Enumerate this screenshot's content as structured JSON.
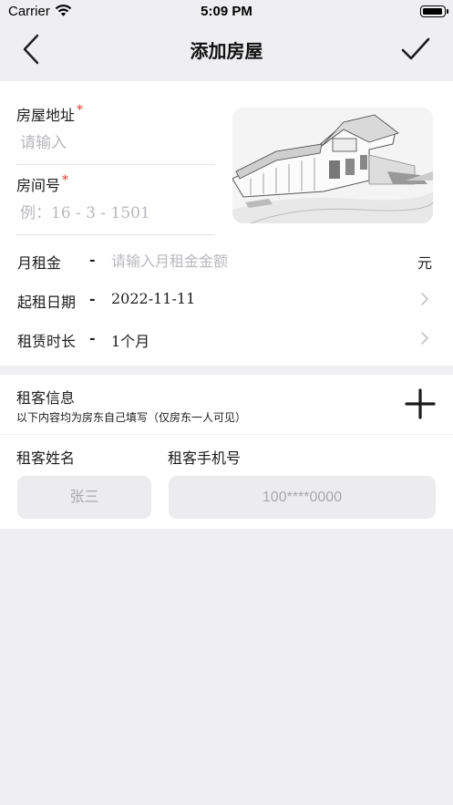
{
  "status_bar": {
    "carrier": "Carrier",
    "time": "5:09 PM",
    "battery_level": 1.0
  },
  "nav": {
    "title": "添加房屋",
    "back_icon": "chevron-left-icon",
    "confirm_icon": "checkmark-icon"
  },
  "house": {
    "address_label": "房屋地址",
    "address_placeholder": "请输入",
    "room_label": "房间号",
    "room_placeholder": "例：16 - 3 - 1501",
    "required_mark": "*",
    "photo": "house-sketch-image",
    "rent": {
      "label": "月租金",
      "dash": "-",
      "placeholder": "请输入月租金金额",
      "unit": "元"
    },
    "start_date": {
      "label": "起租日期",
      "dash": "-",
      "value": "2022-11-11"
    },
    "duration": {
      "label": "租赁时长",
      "dash": "-",
      "value": "1个月"
    }
  },
  "tenant": {
    "title": "租客信息",
    "subtitle": "以下内容均为房东自己填写（仅房东一人可见）",
    "add_icon": "plus-icon",
    "name_label": "租客姓名",
    "phone_label": "租客手机号",
    "name_placeholder": "张三",
    "phone_placeholder": "100****0000"
  },
  "colors": {
    "background": "#efeff1",
    "card": "#ffffff",
    "required": "#e53935",
    "placeholder": "#b8b8bc"
  }
}
